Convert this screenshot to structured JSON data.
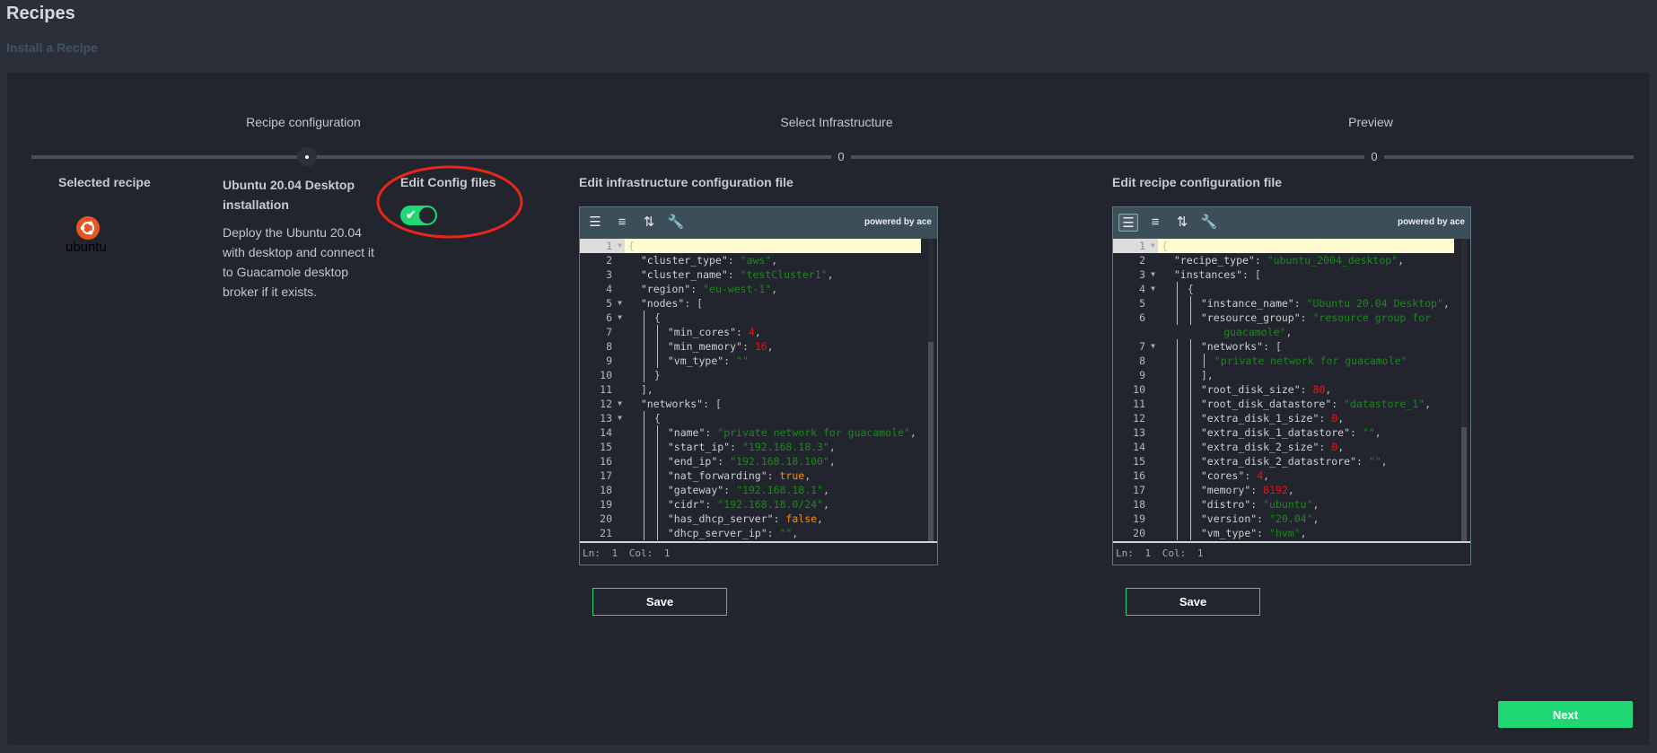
{
  "page": {
    "title": "Recipes",
    "subtitle": "Install a Recipe"
  },
  "steps": [
    {
      "label": "Recipe configuration",
      "marker": "",
      "active": true
    },
    {
      "label": "Select Infrastructure",
      "marker": "0",
      "active": false
    },
    {
      "label": "Preview",
      "marker": "0",
      "active": false
    }
  ],
  "recipe": {
    "selected_heading": "Selected recipe",
    "logo_text": "ubuntu",
    "name": "Ubuntu 20.04 Desktop installation",
    "description": "Deploy the Ubuntu 20.04 with desktop and connect it to Guacamole desktop broker if it exists.",
    "edit_config_label": "Edit Config files",
    "edit_config_enabled": true
  },
  "colors": {
    "accent": "#1fd873",
    "annotation": "#e8261a",
    "ubuntu": "#e95420"
  },
  "editors": [
    {
      "heading": "Edit infrastructure configuration file",
      "powered_by": "powered by ace",
      "status": "Ln: 1  Col: 1",
      "save_label": "Save",
      "scroll_fraction": 0.0,
      "lines": [
        {
          "n": "1",
          "fold": true,
          "g": 0,
          "t": [
            [
              "p",
              "{"
            ]
          ]
        },
        {
          "n": "2",
          "g": 0,
          "t": [
            [
              "k",
              "  \"cluster_type\""
            ],
            [
              "p",
              ": "
            ],
            [
              "s",
              "\"aws\""
            ],
            [
              "p",
              ","
            ]
          ]
        },
        {
          "n": "3",
          "g": 0,
          "t": [
            [
              "k",
              "  \"cluster_name\""
            ],
            [
              "p",
              ": "
            ],
            [
              "s",
              "\"testCluster1\""
            ],
            [
              "p",
              ","
            ]
          ]
        },
        {
          "n": "4",
          "g": 0,
          "t": [
            [
              "k",
              "  \"region\""
            ],
            [
              "p",
              ": "
            ],
            [
              "s",
              "\"eu-west-1\""
            ],
            [
              "p",
              ","
            ]
          ]
        },
        {
          "n": "5",
          "fold": true,
          "g": 0,
          "t": [
            [
              "k",
              "  \"nodes\""
            ],
            [
              "p",
              ": ["
            ]
          ]
        },
        {
          "n": "6",
          "fold": true,
          "g": 1,
          "t": [
            [
              "p",
              "{"
            ]
          ]
        },
        {
          "n": "7",
          "g": 2,
          "t": [
            [
              "k",
              "\"min_cores\""
            ],
            [
              "p",
              ": "
            ],
            [
              "n",
              "4"
            ],
            [
              "p",
              ","
            ]
          ]
        },
        {
          "n": "8",
          "g": 2,
          "t": [
            [
              "k",
              "\"min_memory\""
            ],
            [
              "p",
              ": "
            ],
            [
              "n",
              "16"
            ],
            [
              "p",
              ","
            ]
          ]
        },
        {
          "n": "9",
          "g": 2,
          "t": [
            [
              "k",
              "\"vm_type\""
            ],
            [
              "p",
              ": "
            ],
            [
              "s",
              "\"\""
            ]
          ]
        },
        {
          "n": "10",
          "g": 1,
          "t": [
            [
              "p",
              "}"
            ]
          ]
        },
        {
          "n": "11",
          "g": 0,
          "t": [
            [
              "p",
              "  ],"
            ]
          ]
        },
        {
          "n": "12",
          "fold": true,
          "g": 0,
          "t": [
            [
              "k",
              "  \"networks\""
            ],
            [
              "p",
              ": ["
            ]
          ]
        },
        {
          "n": "13",
          "fold": true,
          "g": 1,
          "t": [
            [
              "p",
              "{"
            ]
          ]
        },
        {
          "n": "14",
          "g": 2,
          "t": [
            [
              "k",
              "\"name\""
            ],
            [
              "p",
              ": "
            ],
            [
              "s",
              "\"private network for guacamole\""
            ],
            [
              "p",
              ","
            ]
          ]
        },
        {
          "n": "15",
          "g": 2,
          "t": [
            [
              "k",
              "\"start_ip\""
            ],
            [
              "p",
              ": "
            ],
            [
              "s",
              "\"192.168.18.3\""
            ],
            [
              "p",
              ","
            ]
          ]
        },
        {
          "n": "16",
          "g": 2,
          "t": [
            [
              "k",
              "\"end_ip\""
            ],
            [
              "p",
              ": "
            ],
            [
              "s",
              "\"192.168.18.100\""
            ],
            [
              "p",
              ","
            ]
          ]
        },
        {
          "n": "17",
          "g": 2,
          "t": [
            [
              "k",
              "\"nat_forwarding\""
            ],
            [
              "p",
              ": "
            ],
            [
              "b",
              "true"
            ],
            [
              "p",
              ","
            ]
          ]
        },
        {
          "n": "18",
          "g": 2,
          "t": [
            [
              "k",
              "\"gateway\""
            ],
            [
              "p",
              ": "
            ],
            [
              "s",
              "\"192.168.18.1\""
            ],
            [
              "p",
              ","
            ]
          ]
        },
        {
          "n": "19",
          "g": 2,
          "t": [
            [
              "k",
              "\"cidr\""
            ],
            [
              "p",
              ": "
            ],
            [
              "s",
              "\"192.168.18.0/24\""
            ],
            [
              "p",
              ","
            ]
          ]
        },
        {
          "n": "20",
          "g": 2,
          "t": [
            [
              "k",
              "\"has_dhcp_server\""
            ],
            [
              "p",
              ": "
            ],
            [
              "b",
              "false"
            ],
            [
              "p",
              ","
            ]
          ]
        },
        {
          "n": "21",
          "g": 2,
          "t": [
            [
              "k",
              "\"dhcp_server_ip\""
            ],
            [
              "p",
              ": "
            ],
            [
              "s",
              "\"\""
            ],
            [
              "p",
              ","
            ]
          ]
        }
      ]
    },
    {
      "heading": "Edit recipe configuration file",
      "powered_by": "powered by ace",
      "status": "Ln: 1  Col: 1",
      "save_label": "Save",
      "scroll_fraction": 0.0,
      "lines": [
        {
          "n": "1",
          "fold": true,
          "g": 0,
          "t": [
            [
              "p",
              "{"
            ]
          ]
        },
        {
          "n": "2",
          "g": 0,
          "t": [
            [
              "k",
              "  \"recipe_type\""
            ],
            [
              "p",
              ": "
            ],
            [
              "s",
              "\"ubuntu_2004_desktop\""
            ],
            [
              "p",
              ","
            ]
          ]
        },
        {
          "n": "3",
          "fold": true,
          "g": 0,
          "t": [
            [
              "k",
              "  \"instances\""
            ],
            [
              "p",
              ": ["
            ]
          ]
        },
        {
          "n": "4",
          "fold": true,
          "g": 1,
          "t": [
            [
              "p",
              "{"
            ]
          ]
        },
        {
          "n": "5",
          "g": 2,
          "t": [
            [
              "k",
              "\"instance_name\""
            ],
            [
              "p",
              ": "
            ],
            [
              "s",
              "\"Ubuntu 20.04 Desktop\""
            ],
            [
              "p",
              ","
            ]
          ]
        },
        {
          "n": "6",
          "g": 2,
          "t": [
            [
              "k",
              "\"resource_group\""
            ],
            [
              "p",
              ": "
            ],
            [
              "s",
              "\"resource group for"
            ]
          ]
        },
        {
          "n": "",
          "g": 0,
          "t": [
            [
              "s",
              "          guacamole\""
            ],
            [
              "p",
              ","
            ]
          ]
        },
        {
          "n": "7",
          "fold": true,
          "g": 2,
          "t": [
            [
              "k",
              "\"networks\""
            ],
            [
              "p",
              ": ["
            ]
          ]
        },
        {
          "n": "8",
          "g": 3,
          "t": [
            [
              "s",
              "\"private network for guacamole\""
            ]
          ]
        },
        {
          "n": "9",
          "g": 2,
          "t": [
            [
              "p",
              "],"
            ]
          ]
        },
        {
          "n": "10",
          "g": 2,
          "t": [
            [
              "k",
              "\"root_disk_size\""
            ],
            [
              "p",
              ": "
            ],
            [
              "n",
              "80"
            ],
            [
              "p",
              ","
            ]
          ]
        },
        {
          "n": "11",
          "g": 2,
          "t": [
            [
              "k",
              "\"root_disk_datastore\""
            ],
            [
              "p",
              ": "
            ],
            [
              "s",
              "\"datastore_1\""
            ],
            [
              "p",
              ","
            ]
          ]
        },
        {
          "n": "12",
          "g": 2,
          "t": [
            [
              "k",
              "\"extra_disk_1_size\""
            ],
            [
              "p",
              ": "
            ],
            [
              "n",
              "0"
            ],
            [
              "p",
              ","
            ]
          ]
        },
        {
          "n": "13",
          "g": 2,
          "t": [
            [
              "k",
              "\"extra_disk_1_datastore\""
            ],
            [
              "p",
              ": "
            ],
            [
              "s",
              "\"\""
            ],
            [
              "p",
              ","
            ]
          ]
        },
        {
          "n": "14",
          "g": 2,
          "t": [
            [
              "k",
              "\"extra_disk_2_size\""
            ],
            [
              "p",
              ": "
            ],
            [
              "n",
              "0"
            ],
            [
              "p",
              ","
            ]
          ]
        },
        {
          "n": "15",
          "g": 2,
          "t": [
            [
              "k",
              "\"extra_disk_2_datastrore\""
            ],
            [
              "p",
              ": "
            ],
            [
              "s",
              "\"\""
            ],
            [
              "p",
              ","
            ]
          ]
        },
        {
          "n": "16",
          "g": 2,
          "t": [
            [
              "k",
              "\"cores\""
            ],
            [
              "p",
              ": "
            ],
            [
              "n",
              "4"
            ],
            [
              "p",
              ","
            ]
          ]
        },
        {
          "n": "17",
          "g": 2,
          "t": [
            [
              "k",
              "\"memory\""
            ],
            [
              "p",
              ": "
            ],
            [
              "n",
              "8192"
            ],
            [
              "p",
              ","
            ]
          ]
        },
        {
          "n": "18",
          "g": 2,
          "t": [
            [
              "k",
              "\"distro\""
            ],
            [
              "p",
              ": "
            ],
            [
              "s",
              "\"ubuntu\""
            ],
            [
              "p",
              ","
            ]
          ]
        },
        {
          "n": "19",
          "g": 2,
          "t": [
            [
              "k",
              "\"version\""
            ],
            [
              "p",
              ": "
            ],
            [
              "s",
              "\"20.04\""
            ],
            [
              "p",
              ","
            ]
          ]
        },
        {
          "n": "20",
          "g": 2,
          "t": [
            [
              "k",
              "\"vm_type\""
            ],
            [
              "p",
              ": "
            ],
            [
              "s",
              "\"hvm\""
            ],
            [
              "p",
              ","
            ]
          ]
        }
      ]
    }
  ],
  "toolbar_icons": [
    "format-icon",
    "compact-icon",
    "sort-icon",
    "settings-wrench-icon"
  ],
  "next_label": "Next"
}
